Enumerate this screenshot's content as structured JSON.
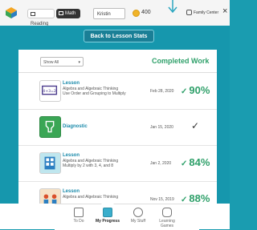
{
  "topbar": {
    "subjects": [
      {
        "label": "Reading",
        "icon": "book-icon"
      },
      {
        "label": "Math",
        "icon": "math-icon"
      }
    ],
    "student_name": "Kristin",
    "coins": "400",
    "family_label": "Family Center",
    "close_symbol": "×"
  },
  "back_button": "Back to Lesson Stats",
  "panel": {
    "filter_value": "Show All",
    "title": "Completed Work",
    "rows": [
      {
        "type": "Lesson",
        "title": "Algebra and Algebraic Thinking",
        "subtitle": "Use Order and Grouping to Multiply",
        "date": "Feb 28, 2020",
        "score": "90%",
        "thumb": "lesson-order-icon"
      },
      {
        "type": "Diagnostic",
        "title": "",
        "subtitle": "",
        "date": "Jan 15, 2020",
        "score": "",
        "thumb": "diagnostic-icon"
      },
      {
        "type": "Lesson",
        "title": "Algebra and Algebraic Thinking",
        "subtitle": "Multiply by 2 with 3, 4, and 8",
        "date": "Jan 2, 2020",
        "score": "84%",
        "thumb": "lesson-multiply-icon"
      },
      {
        "type": "Lesson",
        "title": "Algebra and Algebraic Thinking",
        "subtitle": "",
        "date": "Nov 15, 2019",
        "score": "88%",
        "thumb": "lesson-groups-icon"
      }
    ]
  },
  "bottom_nav": [
    {
      "label": "To Do",
      "icon": "clipboard-icon"
    },
    {
      "label": "My Progress",
      "icon": "progress-icon",
      "active": true
    },
    {
      "label": "My Stuff",
      "icon": "face-icon"
    },
    {
      "label": "Learning Games",
      "icon": "gamepad-icon"
    }
  ],
  "colors": {
    "accent_teal": "#1697ad",
    "score_green": "#2fa06a",
    "link_blue": "#1a8aaa"
  }
}
